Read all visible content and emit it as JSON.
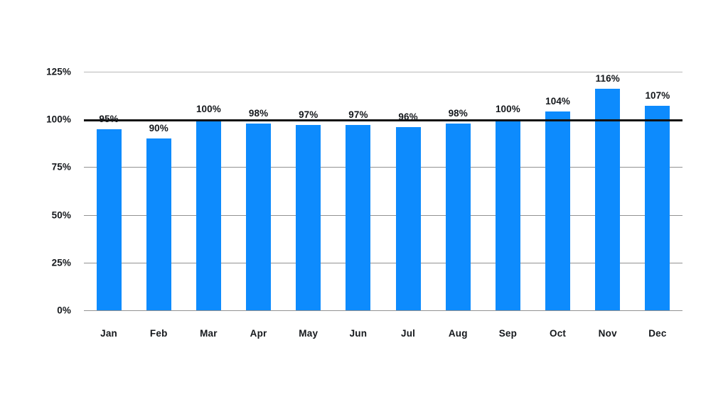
{
  "chart_data": {
    "type": "bar",
    "title": "",
    "subtitle": "",
    "xlabel": "",
    "ylabel": "",
    "categories": [
      "Jan",
      "Feb",
      "Mar",
      "Apr",
      "May",
      "Jun",
      "Jul",
      "Aug",
      "Sep",
      "Oct",
      "Nov",
      "Dec"
    ],
    "values": [
      95,
      90,
      100,
      98,
      97,
      97,
      96,
      98,
      100,
      104,
      116,
      107
    ],
    "value_labels": [
      "95%",
      "90%",
      "100%",
      "98%",
      "97%",
      "97%",
      "96%",
      "98%",
      "100%",
      "104%",
      "116%",
      "107%"
    ],
    "ylim": [
      0,
      125
    ],
    "yticks": [
      0,
      25,
      50,
      75,
      100,
      125
    ],
    "ytick_labels": [
      "0%",
      "25%",
      "50%",
      "75%",
      "100%",
      "125%"
    ],
    "grid": true,
    "legend": false,
    "legend_position": "none",
    "annotations": [
      {
        "type": "reference_line",
        "axis": "y",
        "value": 100,
        "label": "",
        "style": "thick-black"
      }
    ],
    "series": [
      {
        "name": "",
        "values": [
          95,
          90,
          100,
          98,
          97,
          97,
          96,
          98,
          100,
          104,
          116,
          107
        ],
        "color": "#0d8bfd"
      }
    ],
    "colors": {
      "bar": "#0d8bfd",
      "background": "#ffffff",
      "gridline": "#6e6e6e",
      "reference_line": "#111111",
      "text": "#15181c"
    }
  }
}
